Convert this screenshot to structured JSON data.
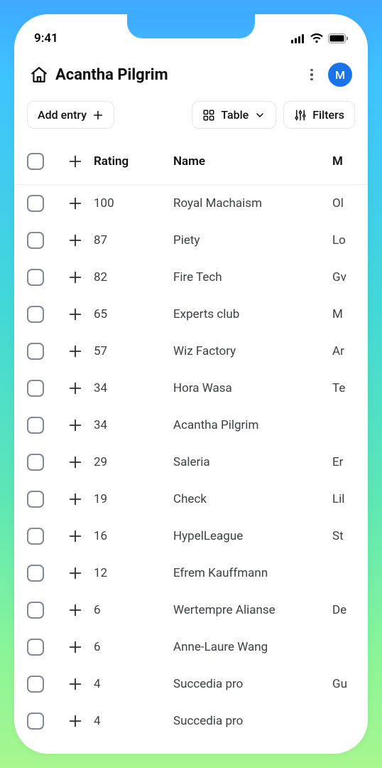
{
  "status": {
    "time": "9:41"
  },
  "header": {
    "title": "Acantha Pilgrim",
    "avatar_initial": "M"
  },
  "toolbar": {
    "add_entry_label": "Add entry",
    "view_label": "Table",
    "filters_label": "Filters"
  },
  "columns": {
    "rating": "Rating",
    "name": "Name",
    "m": "M"
  },
  "rows": [
    {
      "rating": "100",
      "name": "Royal Machaism",
      "m": "Ol"
    },
    {
      "rating": "87",
      "name": "Piety",
      "m": "Lo"
    },
    {
      "rating": "82",
      "name": "Fire Tech",
      "m": "Gv"
    },
    {
      "rating": "65",
      "name": "Experts club",
      "m": "M"
    },
    {
      "rating": "57",
      "name": "Wiz Factory",
      "m": "Ar"
    },
    {
      "rating": "34",
      "name": "Hora Wasa",
      "m": "Te"
    },
    {
      "rating": "34",
      "name": "Acantha Pilgrim",
      "m": ""
    },
    {
      "rating": "29",
      "name": "Saleria",
      "m": "Er"
    },
    {
      "rating": "19",
      "name": "Check",
      "m": "Lil"
    },
    {
      "rating": "16",
      "name": "HypelLeague",
      "m": "St"
    },
    {
      "rating": "12",
      "name": "Efrem Kauffmann",
      "m": ""
    },
    {
      "rating": "6",
      "name": "Wertempre Alianse",
      "m": "De"
    },
    {
      "rating": "6",
      "name": "Anne-Laure Wang",
      "m": ""
    },
    {
      "rating": "4",
      "name": "Succedia pro",
      "m": "Gu"
    },
    {
      "rating": "4",
      "name": "Succedia pro",
      "m": ""
    }
  ]
}
